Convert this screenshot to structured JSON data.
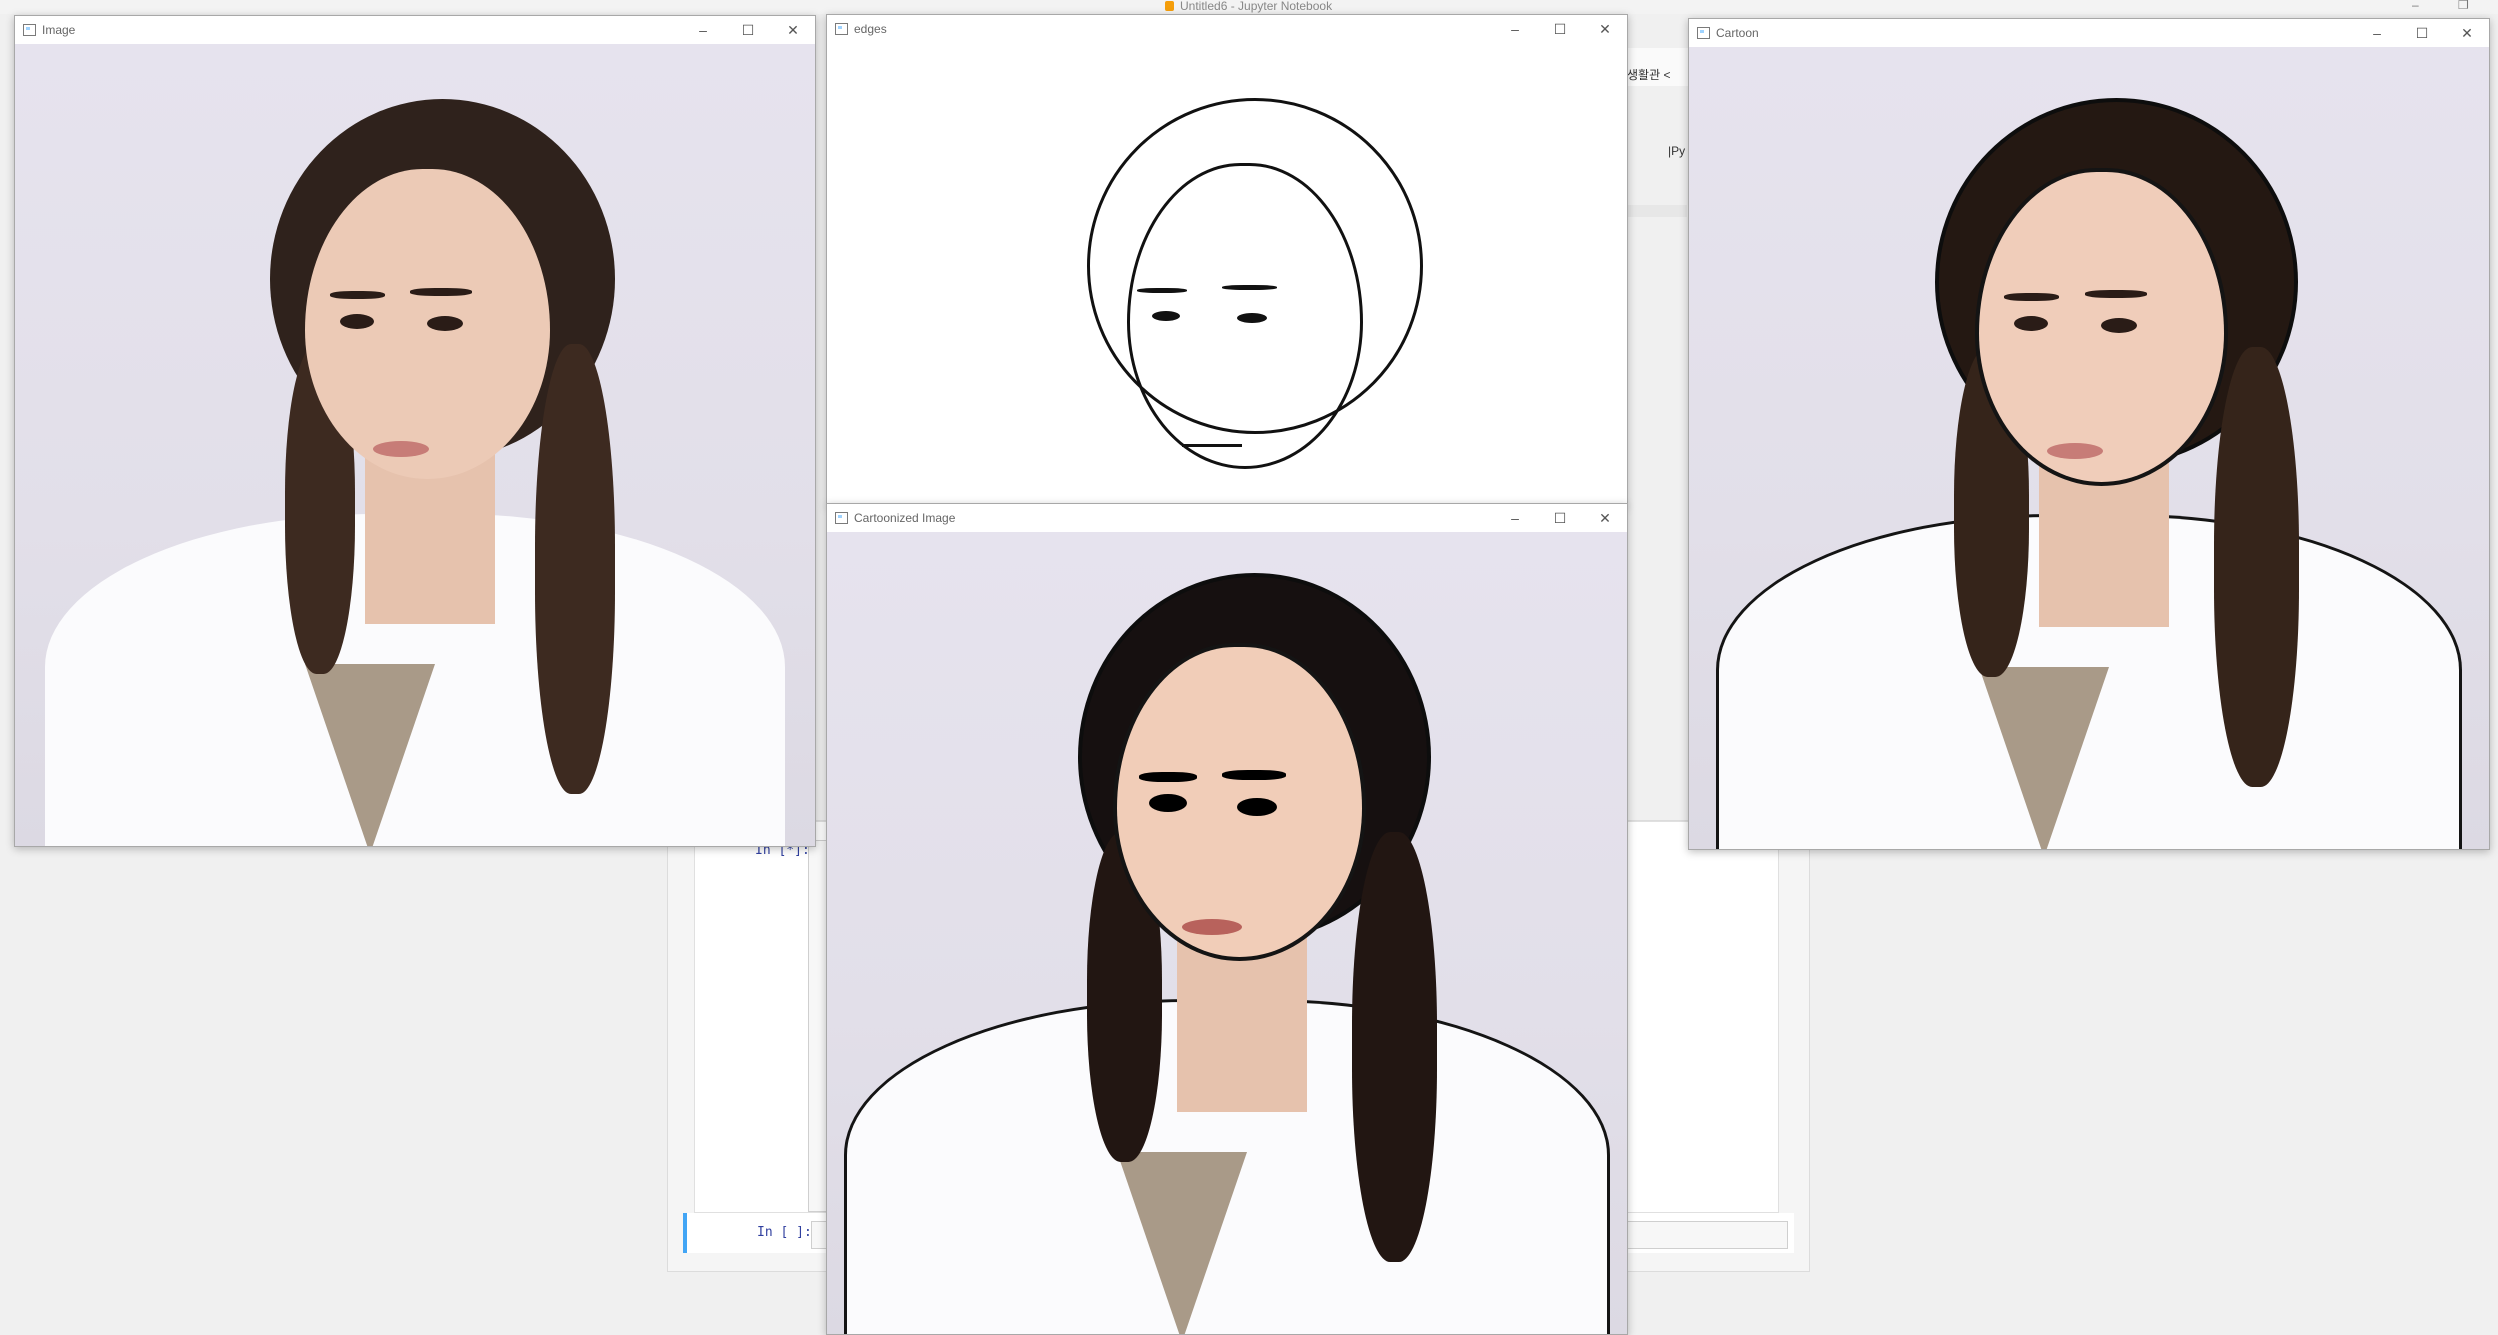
{
  "background_app": {
    "title": "Untitled6 - Jupyter Notebook",
    "toolbar_snippet_1": "생활관 <",
    "toolbar_snippet_2": "|Py",
    "prompt_running": "In [*]:",
    "prompt_empty": "In [ ]:"
  },
  "windows": {
    "image": {
      "title": "Image"
    },
    "edges": {
      "title": "edges"
    },
    "cartoonized": {
      "title": "Cartoonized Image"
    },
    "cartoon": {
      "title": "Cartoon"
    }
  },
  "window_controls": {
    "minimize": "–",
    "maximize": "☐",
    "close": "✕"
  },
  "icons": {
    "app": "opencv-window-icon",
    "minimize": "minimize-icon",
    "maximize": "maximize-icon",
    "close": "close-icon"
  },
  "colors": {
    "prompt_blue": "#303f9f",
    "cell_focus": "#42a5f5"
  }
}
